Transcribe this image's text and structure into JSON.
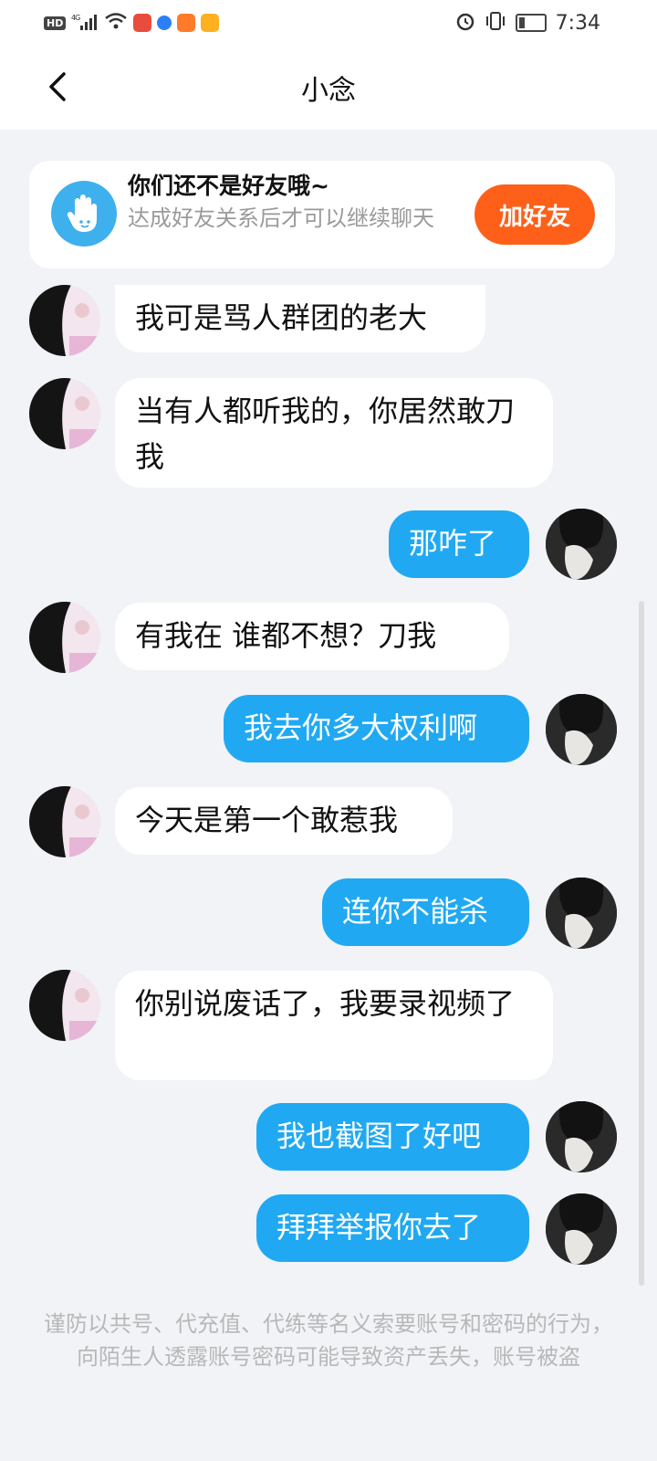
{
  "status_bar": {
    "network": "HD",
    "signal": "4G",
    "time": "7:34"
  },
  "header": {
    "title": "小念"
  },
  "banner": {
    "title": "你们还不是好友哦~",
    "subtitle": "达成好友关系后才可以继续聊天",
    "add_button": "加好友",
    "accent": "#fe6019"
  },
  "messages": [
    {
      "side": "left",
      "text": "我可是骂人群团的老大"
    },
    {
      "side": "left",
      "text": "当有人都听我的，你居然敢刀我"
    },
    {
      "side": "right",
      "text": "那咋了"
    },
    {
      "side": "left",
      "text": "有我在   谁都不想？刀我"
    },
    {
      "side": "right",
      "text": "我去你多大权利啊"
    },
    {
      "side": "left",
      "text": "今天是第一个敢惹我"
    },
    {
      "side": "right",
      "text": "连你不能杀"
    },
    {
      "side": "left",
      "text": "你别说废话了，我要录视频了"
    },
    {
      "side": "right",
      "text": "我也截图了好吧"
    },
    {
      "side": "right",
      "text": "拜拜举报你去了"
    }
  ],
  "footer": {
    "warning": "谨防以共号、代充值、代练等名义索要账号和密码的行为，向陌生人透露账号密码可能导致资产丢失，账号被盗"
  },
  "colors": {
    "outgoing_bubble": "#20a9f2",
    "incoming_bubble": "#ffffff",
    "background": "#f1f3f7"
  }
}
